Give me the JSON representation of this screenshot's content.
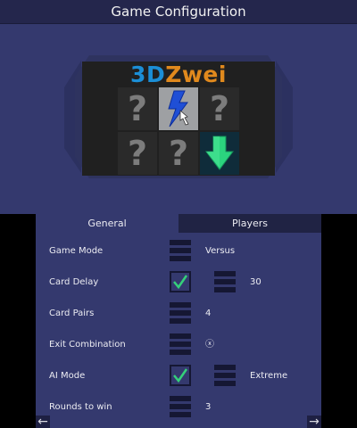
{
  "top_screen": {
    "title": "Game Configuration",
    "logo": {
      "part1": "3D",
      "part2": "Zwei"
    },
    "cards": [
      {
        "kind": "hidden",
        "symbol": "?"
      },
      {
        "kind": "flipped",
        "icon": "lightning-bolt-icon"
      },
      {
        "kind": "hidden",
        "symbol": "?"
      },
      {
        "kind": "hidden",
        "symbol": "?"
      },
      {
        "kind": "hidden",
        "symbol": "?"
      },
      {
        "kind": "flipped",
        "icon": "green-down-arrow-icon"
      }
    ],
    "colors": {
      "background": "#34396e",
      "titlebar": "#24264c",
      "logo_blue": "#1b8ed6",
      "logo_orange": "#e0891d",
      "arrow_green": "#2bd47e"
    }
  },
  "bottom_screen": {
    "tabs": {
      "general": "General",
      "players": "Players",
      "selected": "General"
    },
    "settings": {
      "game_mode": {
        "label": "Game Mode",
        "value": "Versus"
      },
      "card_delay": {
        "label": "Card Delay",
        "checked": true,
        "value": "30"
      },
      "card_pairs": {
        "label": "Card Pairs",
        "value": "4"
      },
      "exit_combination": {
        "label": "Exit Combination",
        "value": "ⓧ"
      },
      "ai_mode": {
        "label": "AI Mode",
        "checked": true,
        "value": "Extreme"
      },
      "rounds_to_win": {
        "label": "Rounds to win",
        "value": "3"
      }
    },
    "nav": {
      "prev_icon": "left-arrow-icon",
      "next_icon": "right-arrow-icon"
    }
  }
}
